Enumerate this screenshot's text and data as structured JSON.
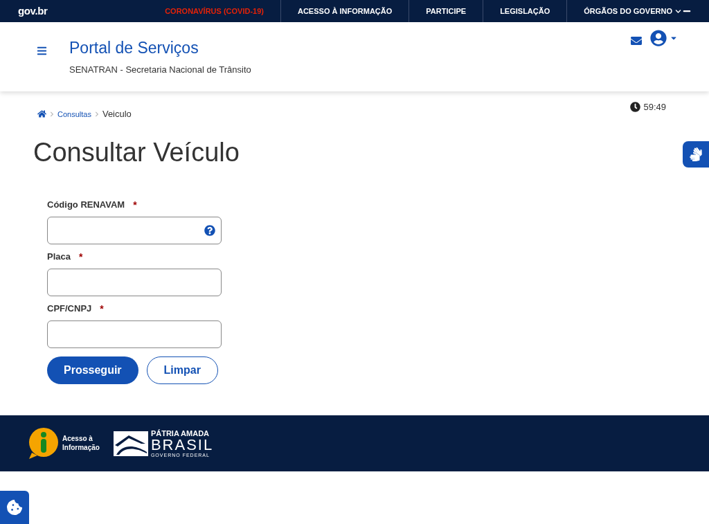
{
  "topbar": {
    "logo": "gov.br",
    "links": [
      {
        "label": "CORONAVÍRUS (COVID-19)",
        "kind": "alert"
      },
      {
        "label": "ACESSO À INFORMAÇÃO",
        "kind": "link"
      },
      {
        "label": "PARTICIPE",
        "kind": "link"
      },
      {
        "label": "LEGISLAÇÃO",
        "kind": "link"
      },
      {
        "label": "ÓRGÃOS DO GOVERNO",
        "kind": "link"
      }
    ]
  },
  "header": {
    "title": "Portal de Serviços",
    "subtitle": "SENATRAN - Secretaria Nacional de Trânsito"
  },
  "breadcrumb": [
    {
      "label": "Consultas",
      "kind": "link"
    },
    {
      "label": "Veiculo",
      "kind": "current"
    }
  ],
  "timer": "59:49",
  "page_title": "Consultar Veículo",
  "required_mark": "*",
  "fields": [
    {
      "label": "Código RENAVAM",
      "required": true,
      "help": true
    },
    {
      "label": "Placa",
      "required": true,
      "help": false
    },
    {
      "label": "CPF/CNPJ",
      "required": true,
      "help": false
    }
  ],
  "buttons": [
    {
      "label": "Prosseguir",
      "kind": "primary"
    },
    {
      "label": "Limpar",
      "kind": "secondary"
    }
  ],
  "footer": {
    "info_logo": [
      "Acesso à",
      "Informação"
    ],
    "brand_logo": {
      "line1": "PÁTRIA AMADA",
      "line2": "BRASIL",
      "line3": "GOVERNO FEDERAL"
    }
  }
}
